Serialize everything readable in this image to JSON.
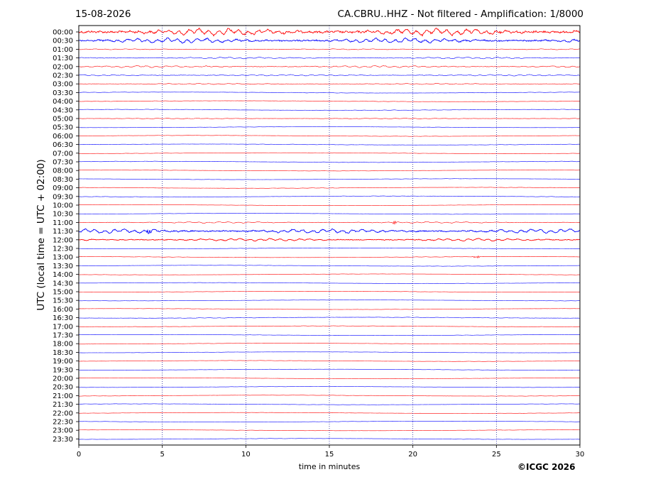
{
  "header": {
    "date": "15-08-2026",
    "station": "CA.CBRU..HHZ - Not filtered - Amplification: 1/8000"
  },
  "credit": "©ICGC 2026",
  "colors": {
    "even_rows": "#ff0000",
    "odd_rows": "#0000ff",
    "grid": "#00008b",
    "frame": "#000000"
  },
  "chart_data": {
    "type": "line",
    "title": "CA.CBRU..HHZ - Not filtered - Amplification: 1/8000",
    "xlabel": "time in minutes",
    "ylabel": "UTC (local time = UTC + 02:00)",
    "xlim": [
      0,
      30
    ],
    "x_ticks": [
      "0",
      "5",
      "10",
      "15",
      "20",
      "25",
      "30"
    ],
    "x_gridlines": [
      5,
      10,
      15,
      20,
      25
    ],
    "grid": "vertical dotted",
    "row_labels": [
      "00:00",
      "00:30",
      "01:00",
      "01:30",
      "02:00",
      "02:30",
      "03:00",
      "03:30",
      "04:00",
      "04:30",
      "05:00",
      "05:30",
      "06:00",
      "06:30",
      "07:00",
      "07:30",
      "08:00",
      "08:30",
      "09:00",
      "09:30",
      "10:00",
      "10:30",
      "11:00",
      "11:30",
      "12:00",
      "12:30",
      "13:00",
      "13:30",
      "14:00",
      "14:30",
      "15:00",
      "15:30",
      "16:00",
      "16:30",
      "17:00",
      "17:30",
      "18:00",
      "18:30",
      "19:00",
      "19:30",
      "20:00",
      "20:30",
      "21:00",
      "21:30",
      "22:00",
      "22:30",
      "23:00",
      "23:30"
    ],
    "row_activity": [
      5.0,
      3.5,
      0.6,
      1.2,
      1.4,
      1.0,
      0.7,
      0.3,
      0.3,
      0.4,
      0.5,
      0.2,
      0.2,
      0.3,
      0.2,
      0.4,
      0.2,
      0.2,
      0.3,
      0.3,
      0.2,
      0.2,
      1.0,
      3.0,
      1.8,
      0.2,
      0.3,
      0.2,
      0.2,
      0.2,
      0.2,
      0.2,
      0.2,
      0.4,
      0.3,
      0.2,
      0.2,
      0.2,
      0.2,
      0.2,
      0.2,
      0.2,
      0.2,
      0.2,
      0.2,
      0.2,
      0.2,
      0.2
    ],
    "events": [
      {
        "row": "11:00",
        "minute": 18.9
      },
      {
        "row": "11:30",
        "minute": 4.2
      },
      {
        "row": "13:00",
        "minute": 23.8
      }
    ]
  }
}
